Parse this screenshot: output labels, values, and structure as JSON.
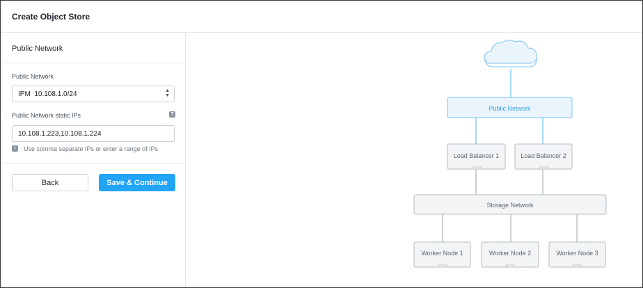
{
  "header": {
    "title": "Create Object Store"
  },
  "left_panel": {
    "section_title": "Public Network",
    "public_network": {
      "label": "Public Network",
      "selected_value": "IPM  10.108.1.0/24"
    },
    "static_ips": {
      "label": "Public Network static IPs",
      "help_icon": "question-icon",
      "value": "10.108.1.223,10.108.1.224",
      "hint_icon": "info-icon",
      "hint": "Use comma separate IPs or enter a range of IPs"
    },
    "buttons": {
      "back": "Back",
      "save": "Save & Continue"
    }
  },
  "diagram": {
    "cloud_icon": "cloud-icon",
    "public_network": "Public Network",
    "load_balancers": [
      "Load Balancer 1",
      "Load Balancer 2"
    ],
    "storage_network": "Storage Network",
    "worker_nodes": [
      "Worker Node 1",
      "Worker Node 2",
      "Worker Node 3"
    ]
  },
  "colors": {
    "accent": "#22a5f7",
    "public_network_fill": "#e9f4fd",
    "public_network_stroke": "#7cc4f3",
    "node_fill": "#f3f4f5",
    "node_stroke": "#b5bcc2"
  }
}
